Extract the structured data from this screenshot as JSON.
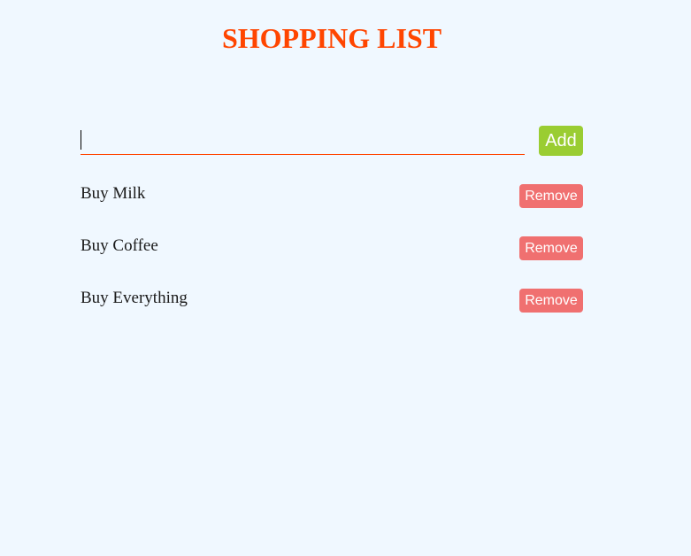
{
  "page": {
    "title": "SHOPPING LIST"
  },
  "form": {
    "input_value": "",
    "input_placeholder": "",
    "add_label": "Add"
  },
  "list": {
    "items": [
      {
        "label": "Buy Milk",
        "remove_label": "Remove"
      },
      {
        "label": "Buy Coffee",
        "remove_label": "Remove"
      },
      {
        "label": "Buy Everything",
        "remove_label": "Remove"
      }
    ]
  },
  "colors": {
    "background": "#f0f8ff",
    "title": "#ff4500",
    "add_button": "#9acd32",
    "remove_button": "#f07070",
    "input_underline": "#ff4500"
  }
}
